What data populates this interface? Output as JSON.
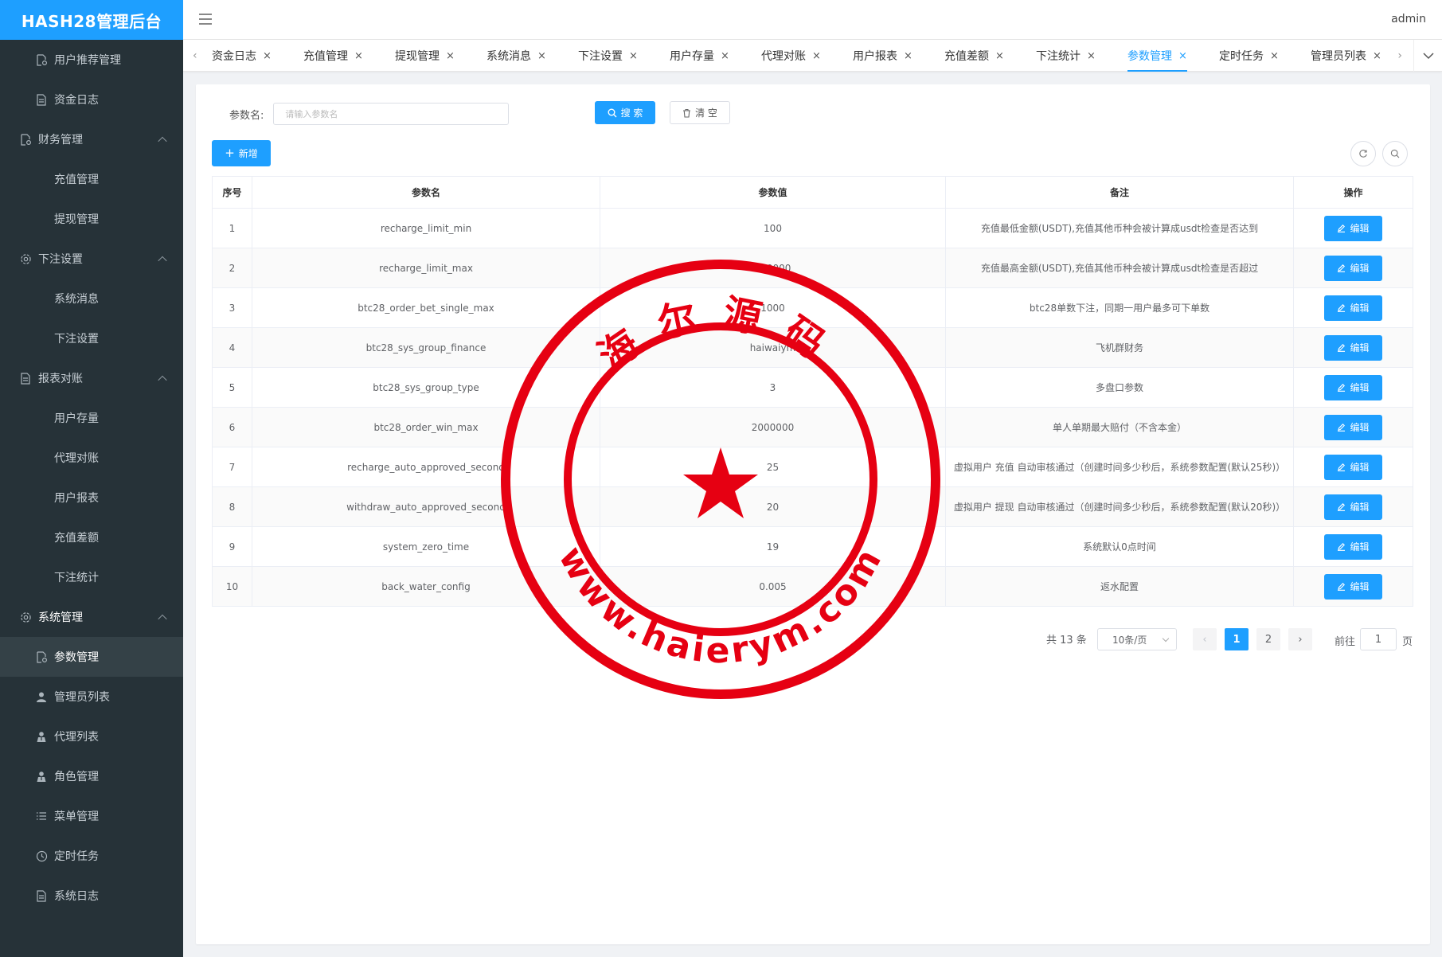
{
  "app": {
    "title": "HASH28管理后台",
    "user": "admin"
  },
  "sidebar": {
    "items": [
      {
        "label": "用户推荐管理",
        "icon": "document-gear-icon",
        "type": "sub"
      },
      {
        "label": "资金日志",
        "icon": "document-icon",
        "type": "sub"
      },
      {
        "label": "财务管理",
        "icon": "document-gear-icon",
        "type": "group"
      },
      {
        "label": "充值管理",
        "type": "sub"
      },
      {
        "label": "提现管理",
        "type": "sub"
      },
      {
        "label": "下注设置",
        "icon": "gear-icon",
        "type": "group"
      },
      {
        "label": "系统消息",
        "type": "sub"
      },
      {
        "label": "下注设置",
        "type": "sub"
      },
      {
        "label": "报表对账",
        "icon": "document-icon",
        "type": "group"
      },
      {
        "label": "用户存量",
        "type": "sub"
      },
      {
        "label": "代理对账",
        "type": "sub"
      },
      {
        "label": "用户报表",
        "type": "sub"
      },
      {
        "label": "充值差额",
        "type": "sub"
      },
      {
        "label": "下注统计",
        "type": "sub"
      },
      {
        "label": "系统管理",
        "icon": "gear-icon",
        "type": "group"
      },
      {
        "label": "参数管理",
        "icon": "document-gear-icon",
        "type": "sub",
        "active": true
      },
      {
        "label": "管理员列表",
        "icon": "user-icon",
        "type": "sub"
      },
      {
        "label": "代理列表",
        "icon": "agent-icon",
        "type": "sub"
      },
      {
        "label": "角色管理",
        "icon": "agent-icon",
        "type": "sub"
      },
      {
        "label": "菜单管理",
        "icon": "list-icon",
        "type": "sub"
      },
      {
        "label": "定时任务",
        "icon": "clock-icon",
        "type": "sub"
      },
      {
        "label": "系统日志",
        "icon": "document-icon",
        "type": "sub"
      }
    ]
  },
  "tabs": [
    {
      "label": "资金日志"
    },
    {
      "label": "充值管理"
    },
    {
      "label": "提现管理"
    },
    {
      "label": "系统消息"
    },
    {
      "label": "下注设置"
    },
    {
      "label": "用户存量"
    },
    {
      "label": "代理对账"
    },
    {
      "label": "用户报表"
    },
    {
      "label": "充值差额"
    },
    {
      "label": "下注统计"
    },
    {
      "label": "参数管理",
      "active": true
    },
    {
      "label": "定时任务"
    },
    {
      "label": "管理员列表"
    }
  ],
  "search": {
    "label": "参数名:",
    "placeholder": "请输入参数名",
    "search_label": "搜 索",
    "clear_label": "清 空"
  },
  "toolbar": {
    "add_label": "新增"
  },
  "table": {
    "headers": [
      "序号",
      "参数名",
      "参数值",
      "备注",
      "操作"
    ],
    "edit_label": "编辑",
    "rows": [
      {
        "no": "1",
        "name": "recharge_limit_min",
        "value": "100",
        "remark": "充值最低金额(USDT),充值其他币种会被计算成usdt检查是否达到"
      },
      {
        "no": "2",
        "name": "recharge_limit_max",
        "value": "500000",
        "remark": "充值最高金额(USDT),充值其他币种会被计算成usdt检查是否超过"
      },
      {
        "no": "3",
        "name": "btc28_order_bet_single_max",
        "value": "1000",
        "remark": "btc28单数下注，同期一用户最多可下单数"
      },
      {
        "no": "4",
        "name": "btc28_sys_group_finance",
        "value": "haiwaiym",
        "remark": "飞机群财务"
      },
      {
        "no": "5",
        "name": "btc28_sys_group_type",
        "value": "3",
        "remark": "多盘口参数"
      },
      {
        "no": "6",
        "name": "btc28_order_win_max",
        "value": "2000000",
        "remark": "单人单期最大赔付（不含本金）"
      },
      {
        "no": "7",
        "name": "recharge_auto_approved_second",
        "value": "25",
        "remark": "虚拟用户 充值 自动审核通过（创建时间多少秒后，系统参数配置(默认25秒)）"
      },
      {
        "no": "8",
        "name": "withdraw_auto_approved_second",
        "value": "20",
        "remark": "虚拟用户 提现 自动审核通过（创建时间多少秒后，系统参数配置(默认20秒)）"
      },
      {
        "no": "9",
        "name": "system_zero_time",
        "value": "19",
        "remark": "系统默认0点时间"
      },
      {
        "no": "10",
        "name": "back_water_config",
        "value": "0.005",
        "remark": "返水配置"
      }
    ]
  },
  "pagination": {
    "total": "共 13 条",
    "page_size": "10条/页",
    "pages": [
      "1",
      "2"
    ],
    "goto_label": "前往",
    "goto_value": "1",
    "unit": "页"
  },
  "watermark": {
    "top_text": "海尔源码",
    "bottom_text": "www.haierym.com",
    "color": "#e60012"
  },
  "colors": {
    "primary": "#1e9fff",
    "sidebar": "#263238",
    "stamp": "#e60012"
  }
}
